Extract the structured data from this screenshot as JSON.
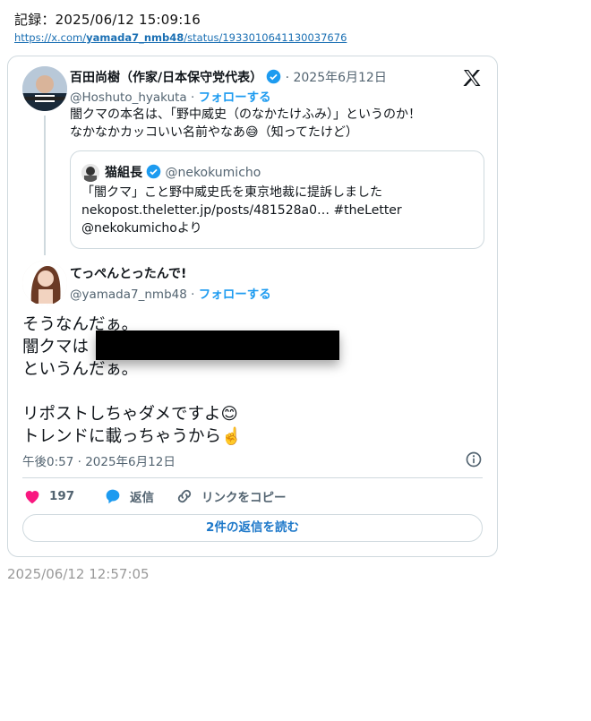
{
  "record": {
    "label": "記録：2025/06/12 15:09:16",
    "url_prefix": "https://x.com/",
    "url_user": "yamada7_nmb48",
    "url_suffix": "/status/1933010641130037676"
  },
  "tweet1": {
    "name": "百田尚樹（作家/日本保守党代表）",
    "date": " · 2025年6月12日",
    "handle": "@Hoshuto_hyakuta",
    "sep": " · ",
    "follow": "フォローする",
    "line1": "闇クマの本名は、「野中威史（のなかたけふみ）」というのか！",
    "line2": "なかなかカッコいい名前やなあ😅（知ってたけど）"
  },
  "quote": {
    "name": "猫組長",
    "handle": "@nekokumicho",
    "line1": "「闇クマ」こと野中威史氏を東京地裁に提訴しました",
    "line2": "nekopost.theletter.jp/posts/481528a0… #theLetter",
    "line3": "@nekokumichoより"
  },
  "tweet2": {
    "name": "てっぺんとったんで!",
    "handle": "@yamada7_nmb48",
    "sep": " · ",
    "follow": "フォローする",
    "line1": "そうなんだぁ。",
    "line2": "闇クマは",
    "line3": "というんだぁ。",
    "line4": "リポストしちゃダメですよ😊",
    "line5": "トレンドに載っちゃうから☝️",
    "time": "午後0:57 · 2025年6月12日"
  },
  "actions": {
    "likes": "197",
    "reply": "返信",
    "copy_link": "リンクをコピー",
    "read_replies": "2件の返信を読む"
  },
  "footer": {
    "timestamp": "2025/06/12 12:57:05"
  },
  "colors": {
    "accent": "#1d9bf0",
    "like": "#f91880",
    "muted": "#536471",
    "border": "#cfd9de"
  }
}
